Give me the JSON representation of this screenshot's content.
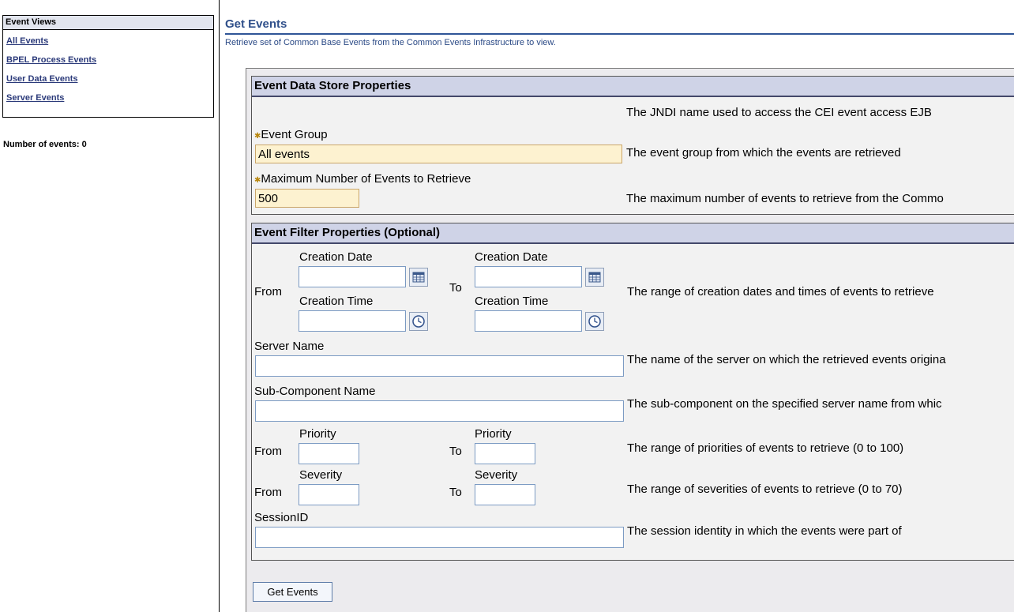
{
  "sidebar": {
    "title": "Event Views",
    "items": [
      {
        "label": "All Events"
      },
      {
        "label": "BPEL Process Events"
      },
      {
        "label": "User Data Events"
      },
      {
        "label": "Server Events"
      }
    ],
    "events_count_label": "Number of events: 0"
  },
  "main": {
    "title": "Get Events",
    "description": "Retrieve set of Common Base Events from the Common Events Infrastructure to view."
  },
  "store": {
    "header": "Event Data Store Properties",
    "jndi_desc": "The JNDI name used to access the CEI event access EJB",
    "event_group": {
      "label": "Event Group",
      "value": "All events",
      "desc": "The event group from which the events are retrieved"
    },
    "max_events": {
      "label": "Maximum Number of Events to Retrieve",
      "value": "500",
      "desc": "The maximum number of events to retrieve from the Commo"
    }
  },
  "filter": {
    "header": "Event Filter Properties (Optional)",
    "from": "From",
    "to": "To",
    "creation_date": "Creation Date",
    "creation_time": "Creation Time",
    "creation_desc": "The range of creation dates and times of events to retrieve",
    "server_name": {
      "label": "Server Name",
      "desc": "The name of the server on which the retrieved events origina"
    },
    "sub_component": {
      "label": "Sub-Component Name",
      "desc": "The sub-component on the specified server name from whic"
    },
    "priority": {
      "label": "Priority",
      "desc": "The range of priorities of events to retrieve (0 to 100)"
    },
    "severity": {
      "label": "Severity",
      "desc": "The range of severities of events to retrieve (0 to 70)"
    },
    "session": {
      "label": "SessionID",
      "desc": "The session identity in which the events were part of"
    }
  },
  "actions": {
    "get_events": "Get Events"
  },
  "colors": {
    "link": "#2b3a7a",
    "title": "#2f4f8a",
    "section_header_bg": "#cfd3e7",
    "required_bg": "#fdf2d0"
  },
  "icons": {
    "required": "asterisk-icon",
    "calendar": "calendar-icon",
    "clock": "clock-icon"
  }
}
